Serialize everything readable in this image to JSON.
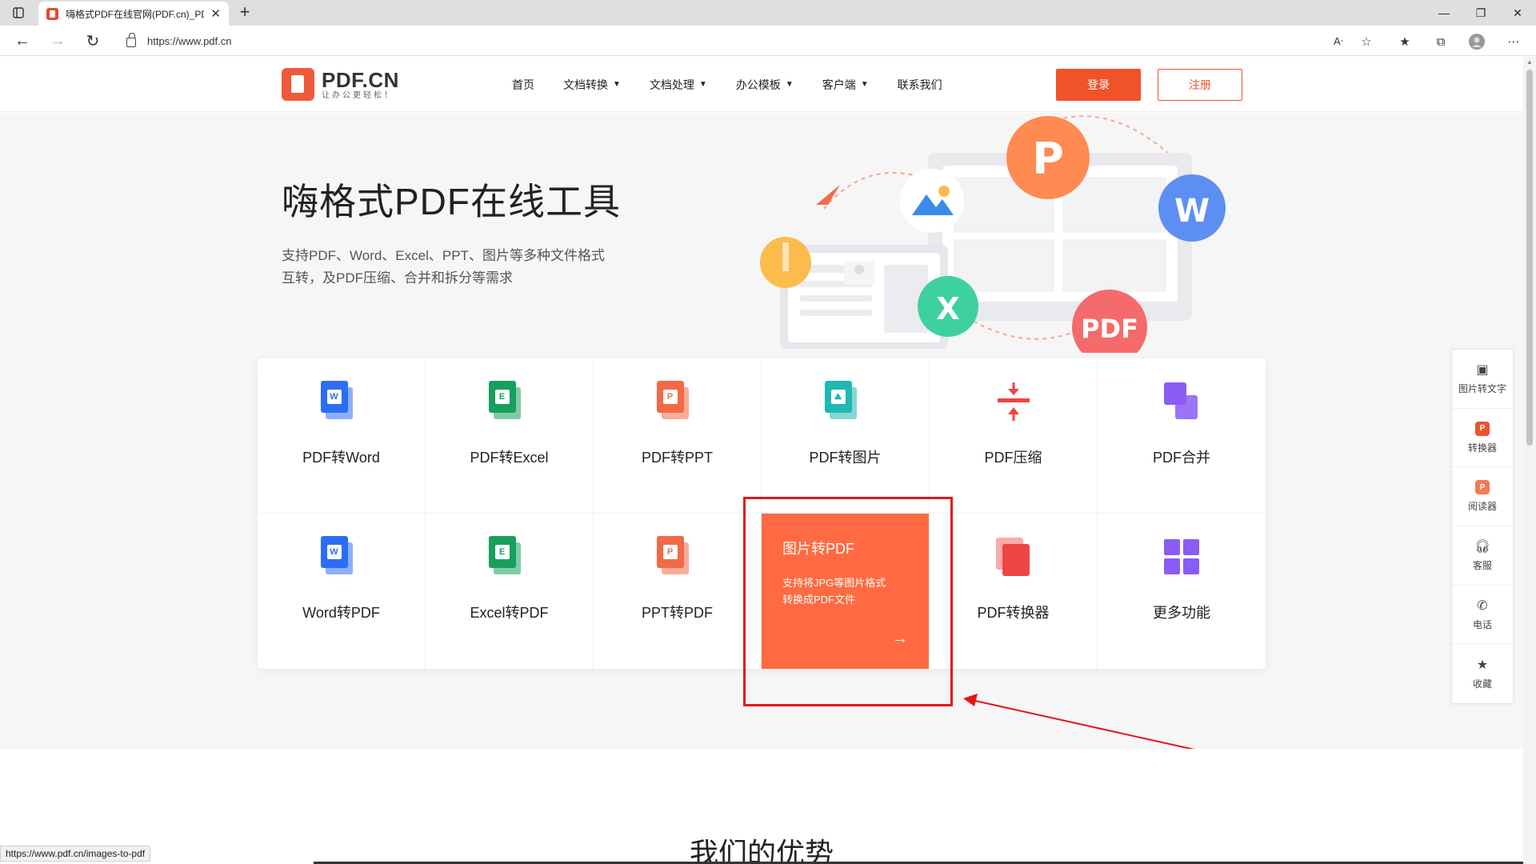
{
  "browser": {
    "tab_title": "嗨格式PDF在线官网(PDF.cn)_PDF",
    "url": "https://www.pdf.cn",
    "status_url": "https://www.pdf.cn/images-to-pdf"
  },
  "header": {
    "logo_name": "PDF.CN",
    "logo_slogan": "让办公更轻松！",
    "nav": [
      {
        "label": "首页",
        "dropdown": false
      },
      {
        "label": "文档转换",
        "dropdown": true
      },
      {
        "label": "文档处理",
        "dropdown": true
      },
      {
        "label": "办公模板",
        "dropdown": true
      },
      {
        "label": "客户端",
        "dropdown": true
      },
      {
        "label": "联系我们",
        "dropdown": false
      }
    ],
    "login_label": "登录",
    "register_label": "注册"
  },
  "hero": {
    "title": "嗨格式PDF在线工具",
    "subtitle_line1": "支持PDF、Word、Excel、PPT、图片等多种文件格式",
    "subtitle_line2": "互转，及PDF压缩、合并和拆分等需求",
    "illustration_letters": {
      "p": "P",
      "w": "W",
      "x": "X",
      "pdf": "PDF"
    }
  },
  "tools": [
    {
      "label": "PDF转Word",
      "icon": "word-doc-icon",
      "color": "#2b6ef5",
      "glyph": "W"
    },
    {
      "label": "PDF转Excel",
      "icon": "excel-doc-icon",
      "color": "#17a05d",
      "glyph": "E"
    },
    {
      "label": "PDF转PPT",
      "icon": "ppt-doc-icon",
      "color": "#f26a45",
      "glyph": "P"
    },
    {
      "label": "PDF转图片",
      "icon": "image-doc-icon",
      "color": "#1fb8b4",
      "glyph": "⛰"
    },
    {
      "label": "PDF压缩",
      "icon": "compress-icon",
      "color": "#ef4444",
      "glyph": ""
    },
    {
      "label": "PDF合并",
      "icon": "merge-icon",
      "color": "#8a5cf6",
      "glyph": ""
    },
    {
      "label": "Word转PDF",
      "icon": "word-doc-icon",
      "color": "#2b6ef5",
      "glyph": "W"
    },
    {
      "label": "Excel转PDF",
      "icon": "excel-doc-icon",
      "color": "#17a05d",
      "glyph": "E"
    },
    {
      "label": "PPT转PDF",
      "icon": "ppt-doc-icon",
      "color": "#f26a45",
      "glyph": "P"
    },
    {
      "label": "图片转PDF",
      "featured": true,
      "desc_line1": "支持将JPG等图片格式",
      "desc_line2": "转换成PDF文件",
      "arrow": "→"
    },
    {
      "label": "PDF转换器",
      "icon": "converter-icon",
      "color": "#ef4444",
      "glyph": ""
    },
    {
      "label": "更多功能",
      "icon": "grid-more-icon",
      "color": "#8a5cf6",
      "glyph": ""
    }
  ],
  "section2": {
    "title": "我们的优势"
  },
  "sidebar": [
    {
      "label": "图片转文字",
      "icon": "image-text-icon"
    },
    {
      "label": "转换器",
      "icon": "converter-app-icon"
    },
    {
      "label": "阅读器",
      "icon": "reader-app-icon"
    },
    {
      "label": "客服",
      "icon": "headset-icon"
    },
    {
      "label": "电话",
      "icon": "phone-icon"
    },
    {
      "label": "收藏",
      "icon": "star-icon"
    }
  ],
  "colors": {
    "brand": "#f0522a",
    "featured": "#ff6a42",
    "annotation": "#e4161b"
  }
}
